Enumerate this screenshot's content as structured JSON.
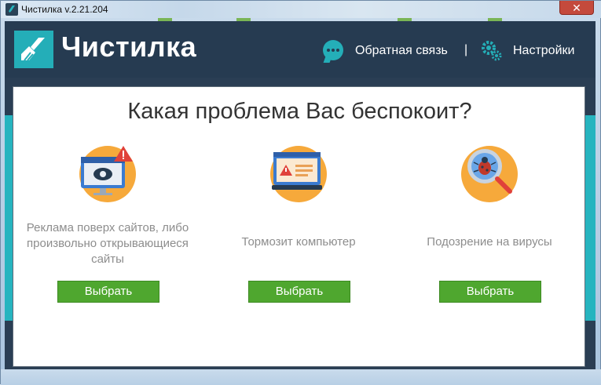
{
  "window": {
    "title": "Чистилка v.2.21.204",
    "close_label": "✕"
  },
  "header": {
    "logo_text": "Чистилка",
    "feedback_label": "Обратная связь",
    "separator": "|",
    "settings_label": "Настройки",
    "accent_color": "#24aeb8",
    "header_color": "#263b51"
  },
  "main": {
    "question": "Какая проблема Вас беспокоит?",
    "options": [
      {
        "label": "Реклама поверх сайтов, либо произвольно открывающиеся сайты",
        "button": "Выбрать",
        "icon": "monitor-eye-warning-icon"
      },
      {
        "label": "Тормозит компьютер",
        "button": "Выбрать",
        "icon": "computer-warning-icon"
      },
      {
        "label": "Подозрение на вирусы",
        "button": "Выбрать",
        "icon": "bug-magnifier-icon"
      }
    ],
    "button_color": "#4fa72f"
  }
}
